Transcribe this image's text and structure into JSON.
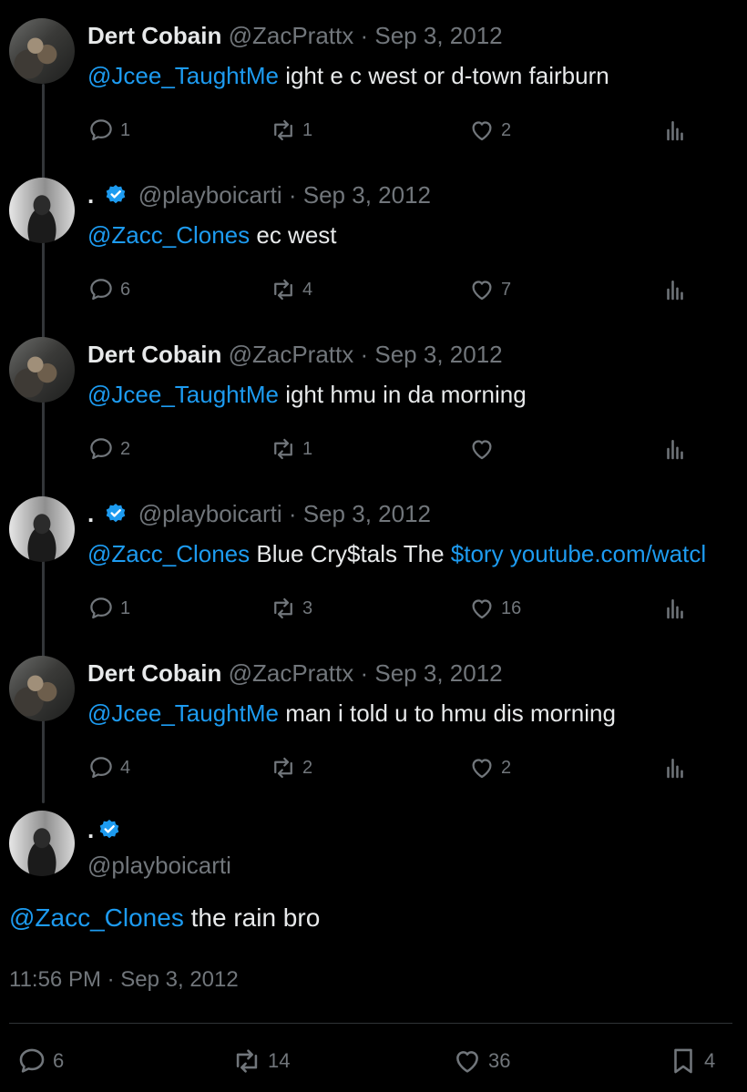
{
  "replies": [
    {
      "author": "Dert Cobain",
      "handle": "@ZacPrattx",
      "date": "Sep 3, 2012",
      "verified": false,
      "mention": "@Jcee_TaughtMe",
      "text": " ight e c west or d-town fairburn",
      "link": "",
      "counts": {
        "reply": "1",
        "retweet": "1",
        "like": "2"
      }
    },
    {
      "author": ".",
      "handle": "@playboicarti",
      "date": "Sep 3, 2012",
      "verified": true,
      "mention": "@Zacc_Clones",
      "text": " ec west",
      "link": "",
      "counts": {
        "reply": "6",
        "retweet": "4",
        "like": "7"
      }
    },
    {
      "author": "Dert Cobain",
      "handle": "@ZacPrattx",
      "date": "Sep 3, 2012",
      "verified": false,
      "mention": "@Jcee_TaughtMe",
      "text": " ight hmu in da morning",
      "link": "",
      "counts": {
        "reply": "2",
        "retweet": "1",
        "like": ""
      }
    },
    {
      "author": ".",
      "handle": "@playboicarti",
      "date": "Sep 3, 2012",
      "verified": true,
      "mention": "@Zacc_Clones",
      "text": " Blue Cry$tals The ",
      "link": "$tory youtube.com/watcl",
      "counts": {
        "reply": "1",
        "retweet": "3",
        "like": "16"
      }
    },
    {
      "author": "Dert Cobain",
      "handle": "@ZacPrattx",
      "date": "Sep 3, 2012",
      "verified": false,
      "mention": "@Jcee_TaughtMe",
      "text": " man i told u to hmu dis morning",
      "link": "",
      "counts": {
        "reply": "4",
        "retweet": "2",
        "like": "2"
      }
    }
  ],
  "main": {
    "author": ".",
    "handle": "@playboicarti",
    "verified": true,
    "mention": "@Zacc_Clones",
    "text": " the rain bro",
    "time": "11:56 PM · Sep 3, 2012",
    "counts": {
      "reply": "6",
      "retweet": "14",
      "like": "36",
      "bookmark": "4"
    }
  },
  "colors": {
    "accent": "#1d9bf0",
    "muted": "#71767b",
    "background": "#000000",
    "text": "#e7e9ea"
  },
  "icons": {
    "reply": "reply-icon",
    "retweet": "retweet-icon",
    "like": "heart-icon",
    "views": "views-icon",
    "bookmark": "bookmark-icon",
    "verified": "verified-badge-icon"
  }
}
